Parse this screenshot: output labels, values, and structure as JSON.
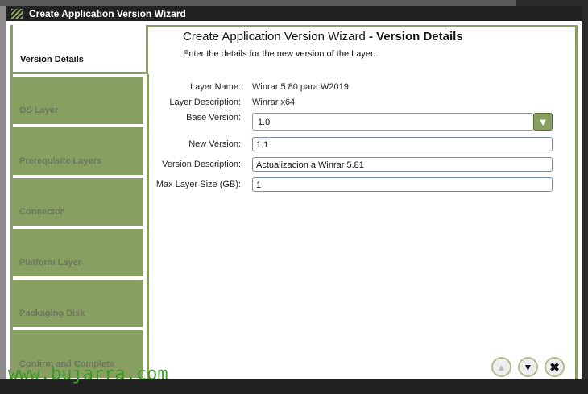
{
  "window": {
    "title": "Create Application Version Wizard"
  },
  "header": {
    "title": "Create Application Version Wizard",
    "subtitle": " - Version Details",
    "description": "Enter the details for the new version of the Layer."
  },
  "nav": {
    "active": "Version Details",
    "items": [
      "OS Layer",
      "Prerequisite Layers",
      "Connector",
      "Platform Layer",
      "Packaging Disk",
      "Confirm and Complete"
    ]
  },
  "form": {
    "layer_name_label": "Layer Name:",
    "layer_name": "Winrar 5.80 para W2019",
    "layer_desc_label": "Layer Description:",
    "layer_desc": "Winrar x64",
    "base_version_label": "Base Version:",
    "base_version": "1.0",
    "new_version_label": "New Version:",
    "new_version": "1.1",
    "version_desc_label": "Version Description:",
    "version_desc": "Actualizacion a Winrar 5.81",
    "max_size_label": "Max Layer Size (GB):",
    "max_size": "1"
  },
  "watermark": "www.bujarra.com"
}
